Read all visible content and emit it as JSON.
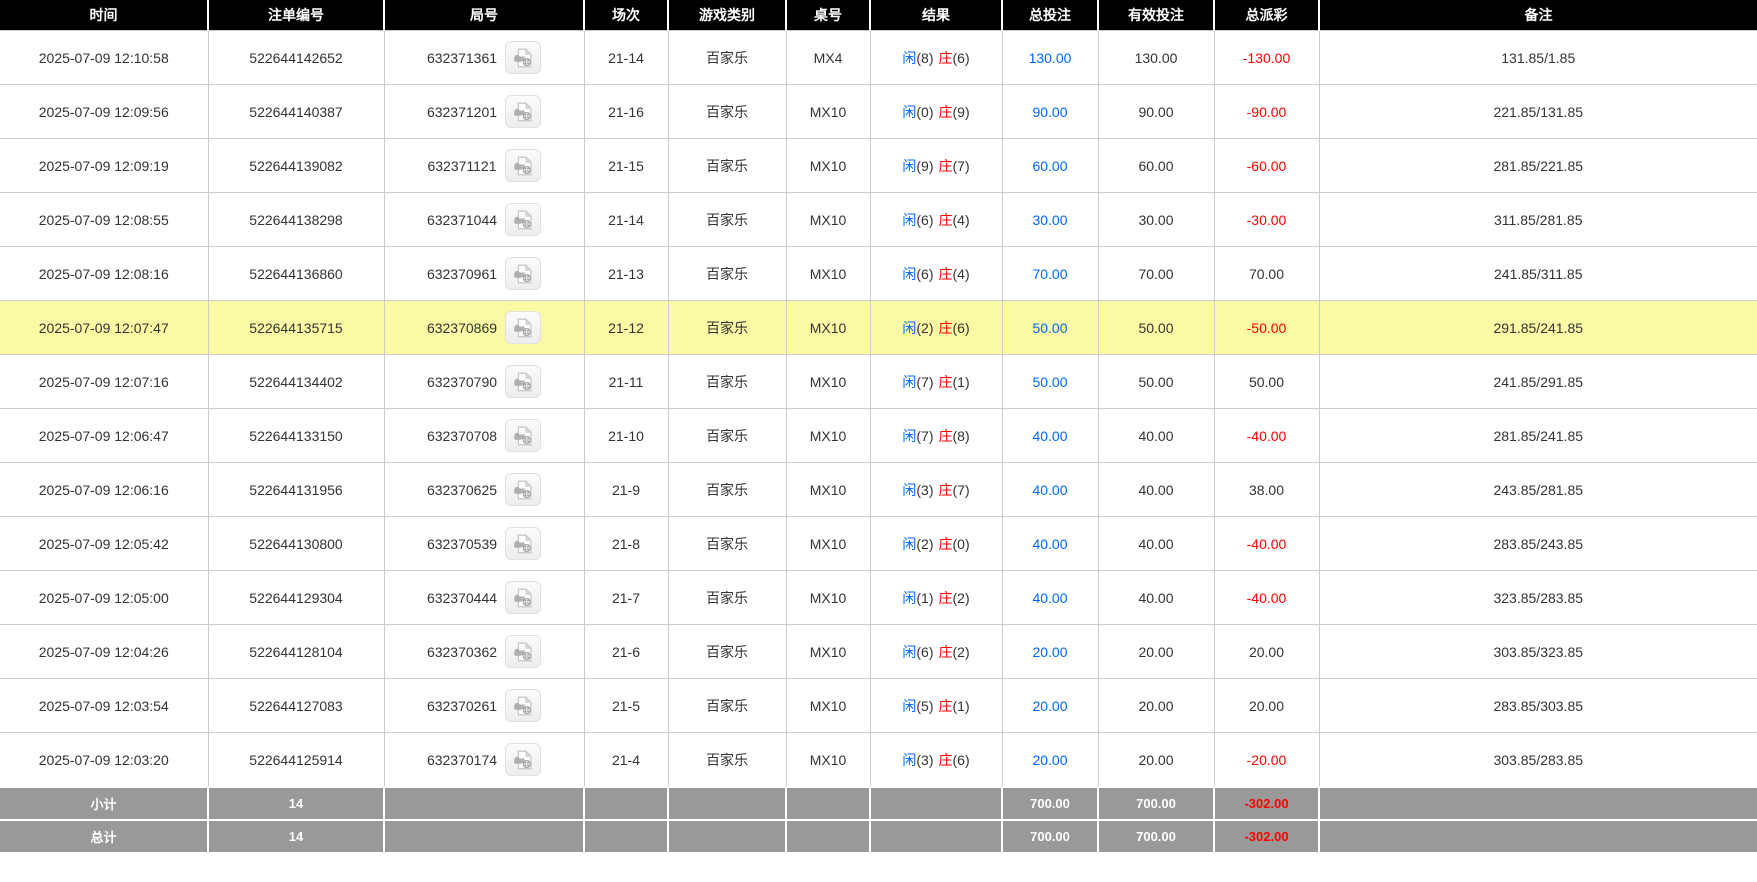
{
  "colors": {
    "header_bg": "#000000",
    "header_text": "#ffffff",
    "grid_border": "#cccccc",
    "body_text": "#333333",
    "player_blue": "#0066ff",
    "banker_red": "#ff0000",
    "bet_blue": "#0066ff",
    "negative_red": "#ff0000",
    "highlight_yellow": "#fafaa5",
    "summary_bg": "#999999",
    "summary_text": "#ffffff"
  },
  "icons": {
    "video_replay": "video-replay-icon"
  },
  "table": {
    "columns": [
      {
        "key": "time",
        "label": "时间"
      },
      {
        "key": "bet_id",
        "label": "注单编号"
      },
      {
        "key": "round",
        "label": "局号"
      },
      {
        "key": "session",
        "label": "场次"
      },
      {
        "key": "game_type",
        "label": "游戏类别"
      },
      {
        "key": "table_no",
        "label": "桌号"
      },
      {
        "key": "result",
        "label": "结果"
      },
      {
        "key": "total_bet",
        "label": "总投注"
      },
      {
        "key": "valid_bet",
        "label": "有效投注"
      },
      {
        "key": "payout",
        "label": "总派彩"
      },
      {
        "key": "remark",
        "label": "备注"
      }
    ],
    "rows": [
      {
        "time": "2025-07-09 12:10:58",
        "bet_id": "522644142652",
        "round": "632371361",
        "session": "21-14",
        "game_type": "百家乐",
        "table_no": "MX4",
        "result": {
          "player": "闲",
          "player_score": "(8)",
          "banker": "庄",
          "banker_score": "(6)"
        },
        "total_bet": "130.00",
        "valid_bet": "130.00",
        "payout": "-130.00",
        "remark": "131.85/1.85",
        "highlighted": false
      },
      {
        "time": "2025-07-09 12:09:56",
        "bet_id": "522644140387",
        "round": "632371201",
        "session": "21-16",
        "game_type": "百家乐",
        "table_no": "MX10",
        "result": {
          "player": "闲",
          "player_score": "(0)",
          "banker": "庄",
          "banker_score": "(9)"
        },
        "total_bet": "90.00",
        "valid_bet": "90.00",
        "payout": "-90.00",
        "remark": "221.85/131.85",
        "highlighted": false
      },
      {
        "time": "2025-07-09 12:09:19",
        "bet_id": "522644139082",
        "round": "632371121",
        "session": "21-15",
        "game_type": "百家乐",
        "table_no": "MX10",
        "result": {
          "player": "闲",
          "player_score": "(9)",
          "banker": "庄",
          "banker_score": "(7)"
        },
        "total_bet": "60.00",
        "valid_bet": "60.00",
        "payout": "-60.00",
        "remark": "281.85/221.85",
        "highlighted": false
      },
      {
        "time": "2025-07-09 12:08:55",
        "bet_id": "522644138298",
        "round": "632371044",
        "session": "21-14",
        "game_type": "百家乐",
        "table_no": "MX10",
        "result": {
          "player": "闲",
          "player_score": "(6)",
          "banker": "庄",
          "banker_score": "(4)"
        },
        "total_bet": "30.00",
        "valid_bet": "30.00",
        "payout": "-30.00",
        "remark": "311.85/281.85",
        "highlighted": false
      },
      {
        "time": "2025-07-09 12:08:16",
        "bet_id": "522644136860",
        "round": "632370961",
        "session": "21-13",
        "game_type": "百家乐",
        "table_no": "MX10",
        "result": {
          "player": "闲",
          "player_score": "(6)",
          "banker": "庄",
          "banker_score": "(4)"
        },
        "total_bet": "70.00",
        "valid_bet": "70.00",
        "payout": "70.00",
        "remark": "241.85/311.85",
        "highlighted": false
      },
      {
        "time": "2025-07-09 12:07:47",
        "bet_id": "522644135715",
        "round": "632370869",
        "session": "21-12",
        "game_type": "百家乐",
        "table_no": "MX10",
        "result": {
          "player": "闲",
          "player_score": "(2)",
          "banker": "庄",
          "banker_score": "(6)"
        },
        "total_bet": "50.00",
        "valid_bet": "50.00",
        "payout": "-50.00",
        "remark": "291.85/241.85",
        "highlighted": true
      },
      {
        "time": "2025-07-09 12:07:16",
        "bet_id": "522644134402",
        "round": "632370790",
        "session": "21-11",
        "game_type": "百家乐",
        "table_no": "MX10",
        "result": {
          "player": "闲",
          "player_score": "(7)",
          "banker": "庄",
          "banker_score": "(1)"
        },
        "total_bet": "50.00",
        "valid_bet": "50.00",
        "payout": "50.00",
        "remark": "241.85/291.85",
        "highlighted": false
      },
      {
        "time": "2025-07-09 12:06:47",
        "bet_id": "522644133150",
        "round": "632370708",
        "session": "21-10",
        "game_type": "百家乐",
        "table_no": "MX10",
        "result": {
          "player": "闲",
          "player_score": "(7)",
          "banker": "庄",
          "banker_score": "(8)"
        },
        "total_bet": "40.00",
        "valid_bet": "40.00",
        "payout": "-40.00",
        "remark": "281.85/241.85",
        "highlighted": false
      },
      {
        "time": "2025-07-09 12:06:16",
        "bet_id": "522644131956",
        "round": "632370625",
        "session": "21-9",
        "game_type": "百家乐",
        "table_no": "MX10",
        "result": {
          "player": "闲",
          "player_score": "(3)",
          "banker": "庄",
          "banker_score": "(7)"
        },
        "total_bet": "40.00",
        "valid_bet": "40.00",
        "payout": "38.00",
        "remark": "243.85/281.85",
        "highlighted": false
      },
      {
        "time": "2025-07-09 12:05:42",
        "bet_id": "522644130800",
        "round": "632370539",
        "session": "21-8",
        "game_type": "百家乐",
        "table_no": "MX10",
        "result": {
          "player": "闲",
          "player_score": "(2)",
          "banker": "庄",
          "banker_score": "(0)"
        },
        "total_bet": "40.00",
        "valid_bet": "40.00",
        "payout": "-40.00",
        "remark": "283.85/243.85",
        "highlighted": false
      },
      {
        "time": "2025-07-09 12:05:00",
        "bet_id": "522644129304",
        "round": "632370444",
        "session": "21-7",
        "game_type": "百家乐",
        "table_no": "MX10",
        "result": {
          "player": "闲",
          "player_score": "(1)",
          "banker": "庄",
          "banker_score": "(2)"
        },
        "total_bet": "40.00",
        "valid_bet": "40.00",
        "payout": "-40.00",
        "remark": "323.85/283.85",
        "highlighted": false
      },
      {
        "time": "2025-07-09 12:04:26",
        "bet_id": "522644128104",
        "round": "632370362",
        "session": "21-6",
        "game_type": "百家乐",
        "table_no": "MX10",
        "result": {
          "player": "闲",
          "player_score": "(6)",
          "banker": "庄",
          "banker_score": "(2)"
        },
        "total_bet": "20.00",
        "valid_bet": "20.00",
        "payout": "20.00",
        "remark": "303.85/323.85",
        "highlighted": false
      },
      {
        "time": "2025-07-09 12:03:54",
        "bet_id": "522644127083",
        "round": "632370261",
        "session": "21-5",
        "game_type": "百家乐",
        "table_no": "MX10",
        "result": {
          "player": "闲",
          "player_score": "(5)",
          "banker": "庄",
          "banker_score": "(1)"
        },
        "total_bet": "20.00",
        "valid_bet": "20.00",
        "payout": "20.00",
        "remark": "283.85/303.85",
        "highlighted": false
      },
      {
        "time": "2025-07-09 12:03:20",
        "bet_id": "522644125914",
        "round": "632370174",
        "session": "21-4",
        "game_type": "百家乐",
        "table_no": "MX10",
        "result": {
          "player": "闲",
          "player_score": "(3)",
          "banker": "庄",
          "banker_score": "(6)"
        },
        "total_bet": "20.00",
        "valid_bet": "20.00",
        "payout": "-20.00",
        "remark": "303.85/283.85",
        "highlighted": false
      }
    ],
    "summary": [
      {
        "label": "小计",
        "count": "14",
        "total_bet": "700.00",
        "valid_bet": "700.00",
        "payout": "-302.00"
      },
      {
        "label": "总计",
        "count": "14",
        "total_bet": "700.00",
        "valid_bet": "700.00",
        "payout": "-302.00"
      }
    ]
  }
}
